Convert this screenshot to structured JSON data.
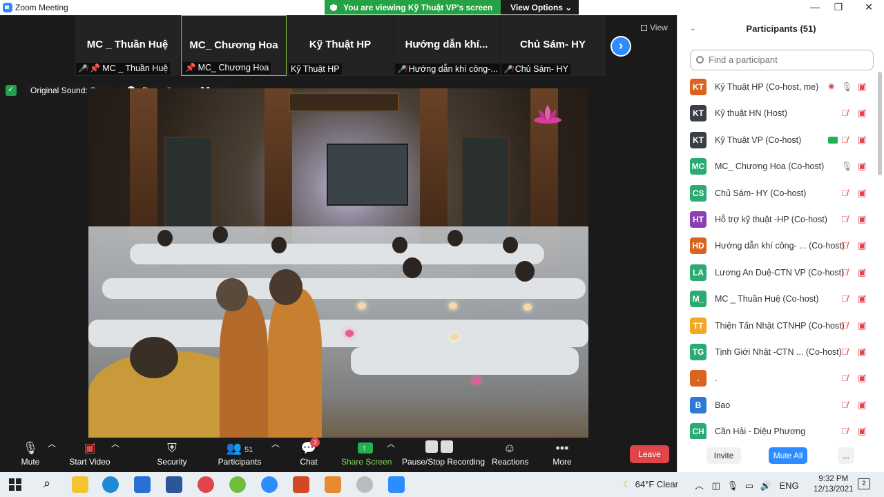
{
  "window": {
    "title": "Zoom Meeting",
    "minimize": "—",
    "maximize": "❐",
    "close": "✕"
  },
  "share_banner": {
    "text": "You are viewing Kỹ Thuật VP's screen",
    "view_options": "View Options ⌄"
  },
  "thumbnails": [
    {
      "big": "MC _ Thuần Huệ",
      "small": "MC _ Thuần Huệ",
      "muted": true,
      "pinned": true,
      "active": false
    },
    {
      "big": "MC_ Chương Hoa",
      "small": "MC_ Chương Hoa",
      "muted": false,
      "pinned": true,
      "active": true
    },
    {
      "big": "Kỹ Thuật HP",
      "small": "Kỹ Thuật HP",
      "muted": false,
      "pinned": false,
      "active": false
    },
    {
      "big": "Hướng  dẫn  khí...",
      "small": "Hướng dẫn khí công-...",
      "muted": true,
      "pinned": false,
      "active": false
    },
    {
      "big": "Chủ Sám- HY",
      "small": "Chủ Sám- HY",
      "muted": true,
      "pinned": false,
      "active": false
    }
  ],
  "view_button": "View",
  "sound": {
    "label": "Original Sound: On",
    "recording": "Recording..."
  },
  "toolbar": {
    "mute": "Mute",
    "start_video": "Start Video",
    "security": "Security",
    "participants": "Participants",
    "participants_count": "51",
    "chat": "Chat",
    "chat_badge": "3",
    "share_screen": "Share Screen",
    "pause_recording": "Pause/Stop Recording",
    "reactions": "Reactions",
    "more": "More",
    "leave": "Leave"
  },
  "panel": {
    "title": "Participants (51)",
    "search_placeholder": "Find a participant",
    "invite": "Invite",
    "mute_all": "Mute All",
    "more": "...",
    "participants": [
      {
        "initials": "KT",
        "name": "Kỹ Thuật HP (Co-host, me)",
        "color": "#d9631f",
        "extra": "rec",
        "mic": "on"
      },
      {
        "initials": "KT",
        "name": "Kỹ thuật HN (Host)",
        "color": "#3a3f47",
        "extra": "",
        "mic": "off"
      },
      {
        "initials": "KT",
        "name": "Kỹ Thuật VP (Co-host)",
        "color": "#3a3f47",
        "extra": "share",
        "mic": "off"
      },
      {
        "initials": "MC",
        "name": "MC_ Chương Hoa (Co-host)",
        "color": "#2bab71",
        "extra": "",
        "mic": "on"
      },
      {
        "initials": "CS",
        "name": "Chủ Sám- HY (Co-host)",
        "color": "#2bab71",
        "extra": "",
        "mic": "off"
      },
      {
        "initials": "HT",
        "name": "Hỗ trợ kỹ thuật -HP (Co-host)",
        "color": "#8a3fb3",
        "extra": "",
        "mic": "off"
      },
      {
        "initials": "HD",
        "name": "Hướng dẫn khí công- ... (Co-host)",
        "color": "#d9631f",
        "extra": "",
        "mic": "off"
      },
      {
        "initials": "LA",
        "name": "Lương An Duệ-CTN VP (Co-host)",
        "color": "#2bab71",
        "extra": "",
        "mic": "off"
      },
      {
        "initials": "M_",
        "name": "MC _ Thuần Huệ (Co-host)",
        "color": "#2bab71",
        "extra": "",
        "mic": "off"
      },
      {
        "initials": "TT",
        "name": "Thiện Tấn Nhật CTNHP (Co-host)",
        "color": "#f5a623",
        "extra": "",
        "mic": "off"
      },
      {
        "initials": "TG",
        "name": "Tịnh Giới Nhật -CTN ...   (Co-host)",
        "color": "#2bab71",
        "extra": "",
        "mic": "off"
      },
      {
        "initials": ".",
        "name": ".",
        "color": "#d9631f",
        "extra": "",
        "mic": "off"
      },
      {
        "initials": "B",
        "name": "Bao",
        "color": "#2d7ad6",
        "extra": "",
        "mic": "off"
      },
      {
        "initials": "CH",
        "name": "Cần Hải - Diệu Phương",
        "color": "#2bab71",
        "extra": "",
        "mic": "off"
      }
    ]
  },
  "taskbar": {
    "weather": "64°F  Clear",
    "language": "ENG",
    "time": "9:32 PM",
    "date": "12/13/2021",
    "notifications": "2"
  }
}
